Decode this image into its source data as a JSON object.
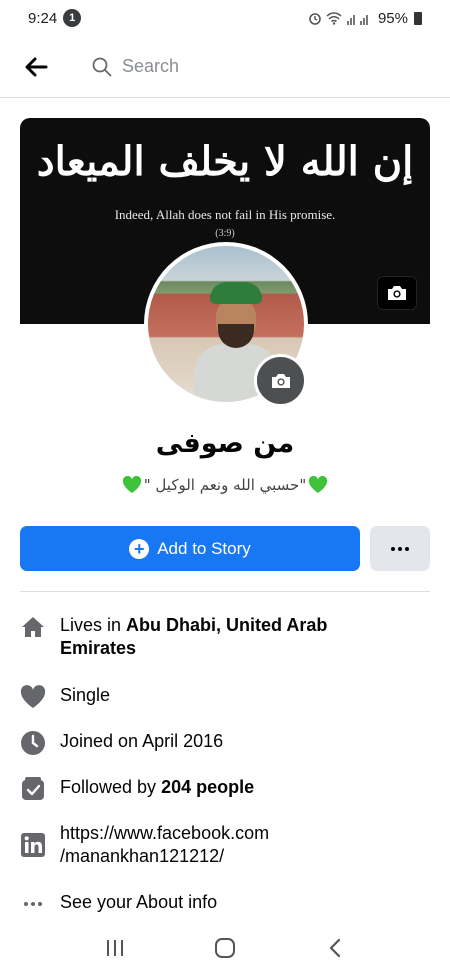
{
  "status_bar": {
    "time": "9:24",
    "notification_count": "1",
    "battery": "95%"
  },
  "header": {
    "search_placeholder": "Search"
  },
  "cover": {
    "arabic_text": "إن الله لا يخلف الميعاد",
    "english_text": "Indeed, Allah does not fail in His promise.",
    "reference": "(3:9)"
  },
  "profile": {
    "name": "من صوفی",
    "bio": "\"حسبي الله ونعم الوكيل \""
  },
  "actions": {
    "add_story_label": "Add to Story"
  },
  "details": {
    "lives_prefix": "Lives in ",
    "lives_place_line1": "Abu Dhabi, United Arab",
    "lives_place_line2": "Emirates",
    "relationship": "Single",
    "joined": "Joined on April 2016",
    "followed_prefix": "Followed by ",
    "followed_count": "204 people",
    "link_line1": "https://www.facebook.com",
    "link_line2": "/manankhan121212/",
    "about": "See your About info"
  },
  "icons": {
    "back": "arrow-left-icon",
    "search": "search-icon",
    "camera": "camera-icon",
    "home": "home-icon",
    "heart": "heart-icon",
    "clock": "clock-icon",
    "followers": "followers-icon",
    "linkedin": "linkedin-icon",
    "more": "more-horizontal-icon",
    "green_heart": "green-heart-icon"
  },
  "colors": {
    "primary": "#1877f2",
    "icon_grey": "#65676b",
    "green_heart": "#3ec33a"
  }
}
